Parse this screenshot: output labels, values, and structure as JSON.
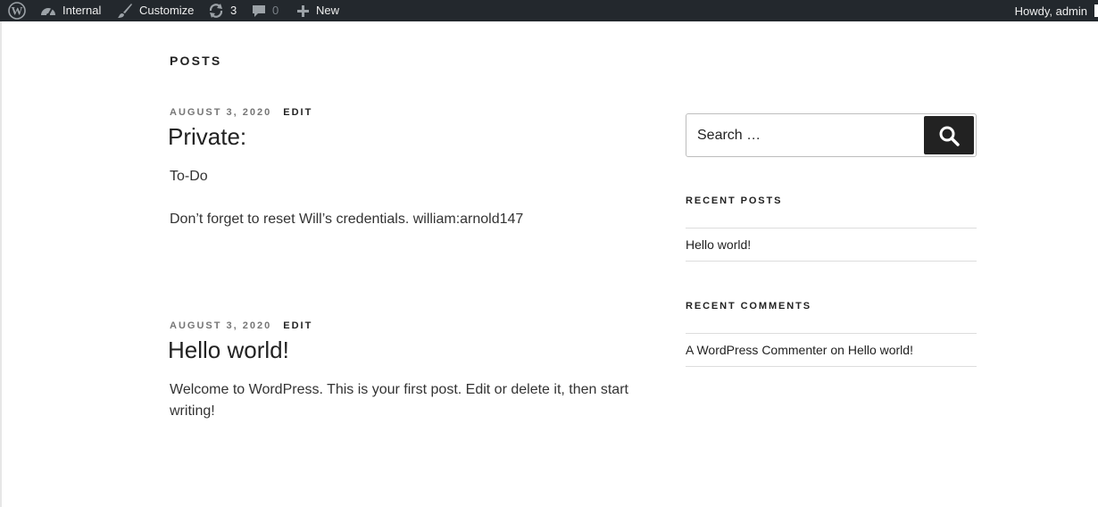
{
  "adminbar": {
    "site_name": "Internal",
    "customize_label": "Customize",
    "updates_count": "3",
    "comments_count": "0",
    "new_label": "New",
    "greeting": "Howdy, admin"
  },
  "page": {
    "title": "Posts"
  },
  "posts": [
    {
      "date": "August 3, 2020",
      "edit_label": "Edit",
      "title": "Private:",
      "paragraphs": [
        "To-Do",
        "Don’t forget to reset Will’s credentials. william:arnold147"
      ]
    },
    {
      "date": "August 3, 2020",
      "edit_label": "Edit",
      "title": "Hello world!",
      "paragraphs": [
        "Welcome to WordPress. This is your first post. Edit or delete it, then start writing!"
      ]
    }
  ],
  "sidebar": {
    "search": {
      "placeholder": "Search …"
    },
    "recent_posts": {
      "title": "Recent Posts",
      "items": [
        "Hello world!"
      ]
    },
    "recent_comments": {
      "title": "Recent Comments",
      "items": [
        {
          "author": "A WordPress Commenter",
          "connector": "on",
          "post": "Hello world!"
        }
      ]
    }
  },
  "colors": {
    "adminbar_bg": "#23282d",
    "text": "#222222",
    "meta": "#767676",
    "button": "#222222"
  },
  "icons": [
    "wordpress-logo-icon",
    "dashboard-icon",
    "brush-icon",
    "updates-icon",
    "comment-icon",
    "plus-icon",
    "search-icon"
  ]
}
